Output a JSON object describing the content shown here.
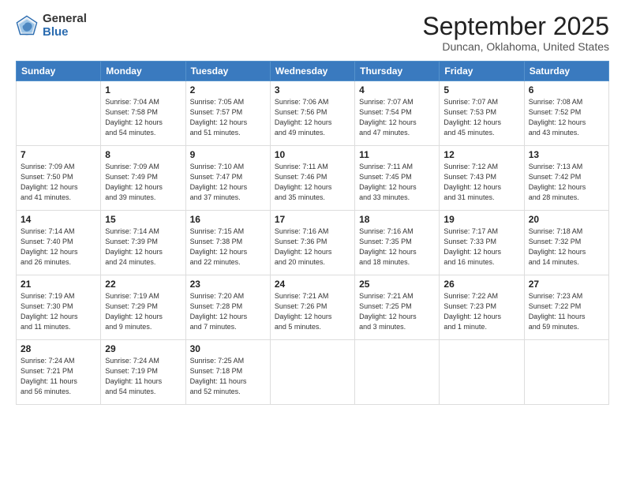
{
  "logo": {
    "general": "General",
    "blue": "Blue"
  },
  "title": "September 2025",
  "location": "Duncan, Oklahoma, United States",
  "days_of_week": [
    "Sunday",
    "Monday",
    "Tuesday",
    "Wednesday",
    "Thursday",
    "Friday",
    "Saturday"
  ],
  "weeks": [
    [
      {
        "day": "",
        "info": ""
      },
      {
        "day": "1",
        "info": "Sunrise: 7:04 AM\nSunset: 7:58 PM\nDaylight: 12 hours\nand 54 minutes."
      },
      {
        "day": "2",
        "info": "Sunrise: 7:05 AM\nSunset: 7:57 PM\nDaylight: 12 hours\nand 51 minutes."
      },
      {
        "day": "3",
        "info": "Sunrise: 7:06 AM\nSunset: 7:56 PM\nDaylight: 12 hours\nand 49 minutes."
      },
      {
        "day": "4",
        "info": "Sunrise: 7:07 AM\nSunset: 7:54 PM\nDaylight: 12 hours\nand 47 minutes."
      },
      {
        "day": "5",
        "info": "Sunrise: 7:07 AM\nSunset: 7:53 PM\nDaylight: 12 hours\nand 45 minutes."
      },
      {
        "day": "6",
        "info": "Sunrise: 7:08 AM\nSunset: 7:52 PM\nDaylight: 12 hours\nand 43 minutes."
      }
    ],
    [
      {
        "day": "7",
        "info": "Sunrise: 7:09 AM\nSunset: 7:50 PM\nDaylight: 12 hours\nand 41 minutes."
      },
      {
        "day": "8",
        "info": "Sunrise: 7:09 AM\nSunset: 7:49 PM\nDaylight: 12 hours\nand 39 minutes."
      },
      {
        "day": "9",
        "info": "Sunrise: 7:10 AM\nSunset: 7:47 PM\nDaylight: 12 hours\nand 37 minutes."
      },
      {
        "day": "10",
        "info": "Sunrise: 7:11 AM\nSunset: 7:46 PM\nDaylight: 12 hours\nand 35 minutes."
      },
      {
        "day": "11",
        "info": "Sunrise: 7:11 AM\nSunset: 7:45 PM\nDaylight: 12 hours\nand 33 minutes."
      },
      {
        "day": "12",
        "info": "Sunrise: 7:12 AM\nSunset: 7:43 PM\nDaylight: 12 hours\nand 31 minutes."
      },
      {
        "day": "13",
        "info": "Sunrise: 7:13 AM\nSunset: 7:42 PM\nDaylight: 12 hours\nand 28 minutes."
      }
    ],
    [
      {
        "day": "14",
        "info": "Sunrise: 7:14 AM\nSunset: 7:40 PM\nDaylight: 12 hours\nand 26 minutes."
      },
      {
        "day": "15",
        "info": "Sunrise: 7:14 AM\nSunset: 7:39 PM\nDaylight: 12 hours\nand 24 minutes."
      },
      {
        "day": "16",
        "info": "Sunrise: 7:15 AM\nSunset: 7:38 PM\nDaylight: 12 hours\nand 22 minutes."
      },
      {
        "day": "17",
        "info": "Sunrise: 7:16 AM\nSunset: 7:36 PM\nDaylight: 12 hours\nand 20 minutes."
      },
      {
        "day": "18",
        "info": "Sunrise: 7:16 AM\nSunset: 7:35 PM\nDaylight: 12 hours\nand 18 minutes."
      },
      {
        "day": "19",
        "info": "Sunrise: 7:17 AM\nSunset: 7:33 PM\nDaylight: 12 hours\nand 16 minutes."
      },
      {
        "day": "20",
        "info": "Sunrise: 7:18 AM\nSunset: 7:32 PM\nDaylight: 12 hours\nand 14 minutes."
      }
    ],
    [
      {
        "day": "21",
        "info": "Sunrise: 7:19 AM\nSunset: 7:30 PM\nDaylight: 12 hours\nand 11 minutes."
      },
      {
        "day": "22",
        "info": "Sunrise: 7:19 AM\nSunset: 7:29 PM\nDaylight: 12 hours\nand 9 minutes."
      },
      {
        "day": "23",
        "info": "Sunrise: 7:20 AM\nSunset: 7:28 PM\nDaylight: 12 hours\nand 7 minutes."
      },
      {
        "day": "24",
        "info": "Sunrise: 7:21 AM\nSunset: 7:26 PM\nDaylight: 12 hours\nand 5 minutes."
      },
      {
        "day": "25",
        "info": "Sunrise: 7:21 AM\nSunset: 7:25 PM\nDaylight: 12 hours\nand 3 minutes."
      },
      {
        "day": "26",
        "info": "Sunrise: 7:22 AM\nSunset: 7:23 PM\nDaylight: 12 hours\nand 1 minute."
      },
      {
        "day": "27",
        "info": "Sunrise: 7:23 AM\nSunset: 7:22 PM\nDaylight: 11 hours\nand 59 minutes."
      }
    ],
    [
      {
        "day": "28",
        "info": "Sunrise: 7:24 AM\nSunset: 7:21 PM\nDaylight: 11 hours\nand 56 minutes."
      },
      {
        "day": "29",
        "info": "Sunrise: 7:24 AM\nSunset: 7:19 PM\nDaylight: 11 hours\nand 54 minutes."
      },
      {
        "day": "30",
        "info": "Sunrise: 7:25 AM\nSunset: 7:18 PM\nDaylight: 11 hours\nand 52 minutes."
      },
      {
        "day": "",
        "info": ""
      },
      {
        "day": "",
        "info": ""
      },
      {
        "day": "",
        "info": ""
      },
      {
        "day": "",
        "info": ""
      }
    ]
  ]
}
